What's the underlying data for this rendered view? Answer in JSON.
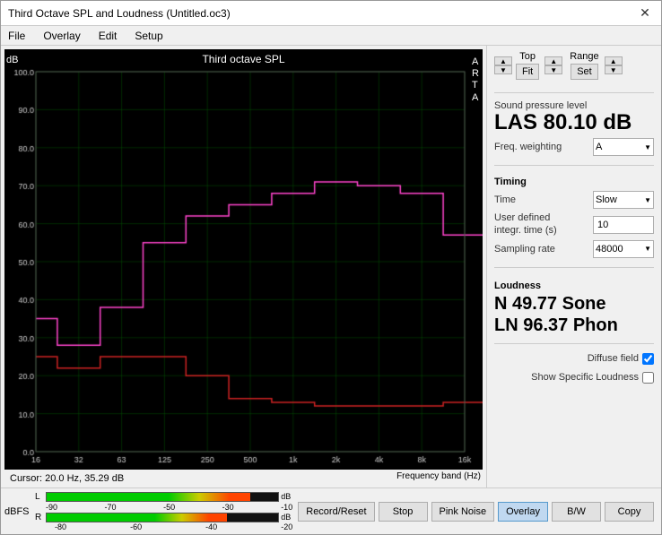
{
  "window": {
    "title": "Third Octave SPL and Loudness (Untitled.oc3)"
  },
  "menu": {
    "items": [
      "File",
      "Overlay",
      "Edit",
      "Setup"
    ]
  },
  "chart": {
    "title": "Third octave SPL",
    "arta_label": "A\nR\nT\nA",
    "y_axis_label": "dB",
    "y_max": "100.0",
    "cursor_info": "Cursor:  20.0 Hz, 35.29 dB",
    "freq_band_label": "Frequency band (Hz)",
    "x_labels": [
      "16",
      "32",
      "63",
      "125",
      "250",
      "500",
      "1k",
      "2k",
      "4k",
      "8k",
      "16k"
    ],
    "y_labels": [
      "10.0",
      "20.0",
      "30.0",
      "40.0",
      "50.0",
      "60.0",
      "70.0",
      "80.0",
      "90.0",
      "100.0"
    ]
  },
  "controls": {
    "top_label": "Top",
    "range_label": "Range",
    "fit_label": "Fit",
    "set_label": "Set"
  },
  "spl": {
    "section_label": "Sound pressure level",
    "value": "LAS 80.10 dB",
    "freq_weighting_label": "Freq. weighting",
    "freq_weighting_value": "A"
  },
  "timing": {
    "section_label": "Timing",
    "time_label": "Time",
    "time_value": "Slow",
    "user_defined_label": "User defined integr. time (s)",
    "user_defined_value": "10",
    "sampling_rate_label": "Sampling rate",
    "sampling_rate_value": "48000"
  },
  "loudness": {
    "section_label": "Loudness",
    "n_value": "N 49.77 Sone",
    "ln_value": "LN 96.37 Phon",
    "diffuse_field_label": "Diffuse field",
    "diffuse_field_checked": true,
    "show_specific_label": "Show Specific Loudness",
    "show_specific_checked": false
  },
  "bottom_bar": {
    "dbfs_label": "dBFS",
    "l_label": "L",
    "r_label": "R",
    "db_label1": "dB",
    "db_label2": "dB",
    "level_labels_top": [
      "-90",
      "-70",
      "-50",
      "-30",
      "-10"
    ],
    "level_labels_bot": [
      "-80",
      "-60",
      "-40",
      "-20"
    ],
    "buttons": [
      "Record/Reset",
      "Stop",
      "Pink Noise",
      "Overlay",
      "B/W",
      "Copy"
    ],
    "active_button": "Overlay"
  }
}
